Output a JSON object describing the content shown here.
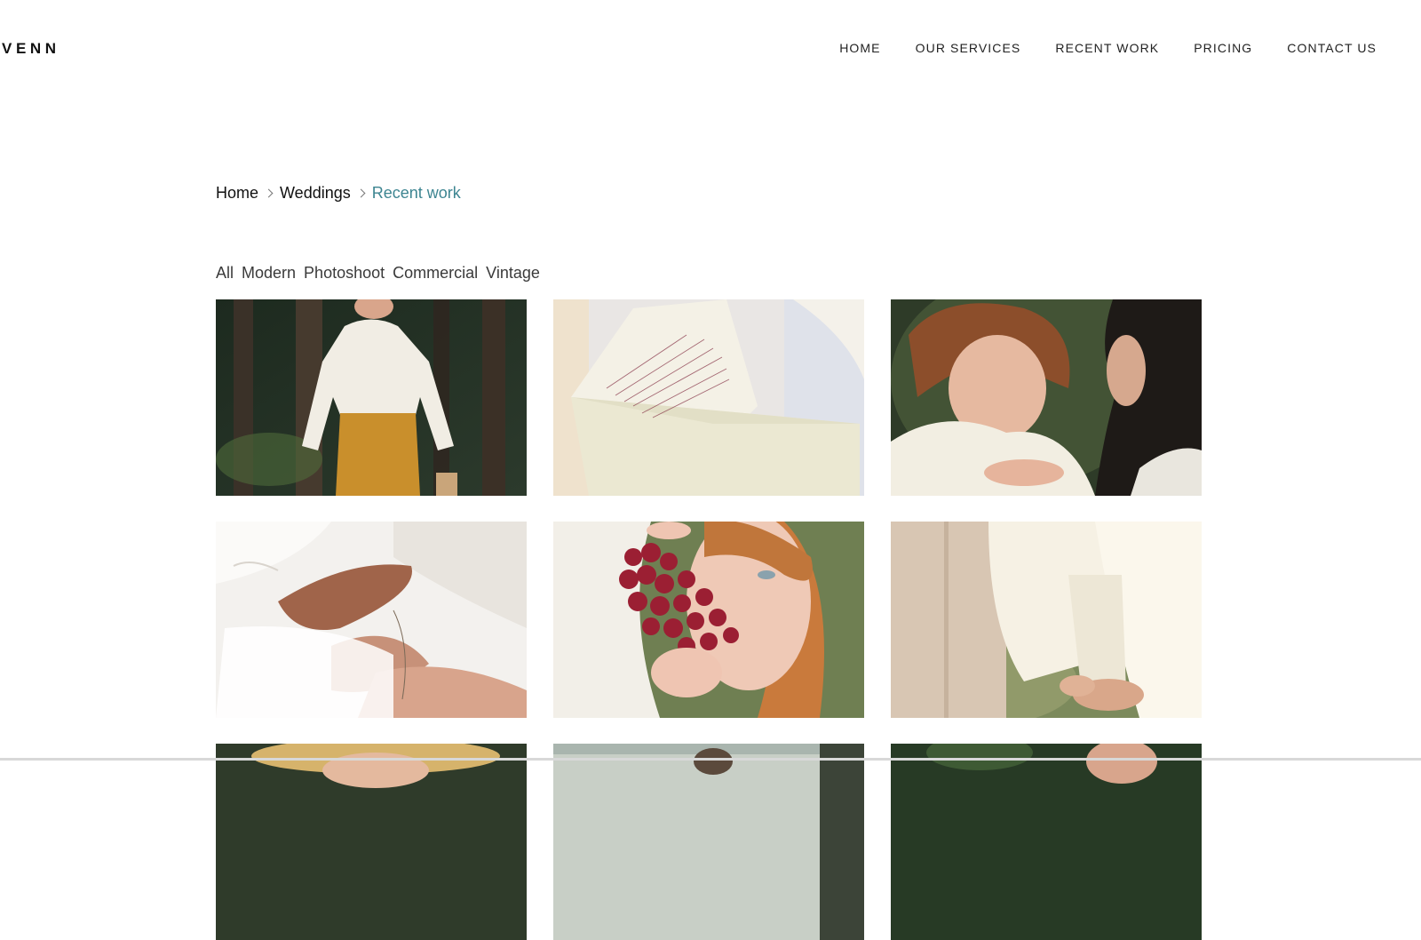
{
  "header": {
    "logo": "VENN",
    "nav": [
      {
        "label": "HOME"
      },
      {
        "label": "OUR SERVICES"
      },
      {
        "label": "RECENT WORK"
      },
      {
        "label": "PRICING"
      },
      {
        "label": "CONTACT US"
      }
    ]
  },
  "breadcrumb": {
    "items": [
      "Home",
      "Weddings",
      "Recent work"
    ]
  },
  "filters": [
    "All",
    "Modern",
    "Photoshoot",
    "Commercial",
    "Vintage"
  ],
  "colors": {
    "accent": "#3d8591",
    "text": "#111111",
    "muted": "#3a3a3a"
  },
  "gallery": {
    "images": [
      {
        "subject": "woman in white ruffled blouse and mustard trousers in forest"
      },
      {
        "subject": "handwritten letter in cream envelope"
      },
      {
        "subject": "two women face to face, red-haired woman in white blouse"
      },
      {
        "subject": "hands fastening white lace sleeve"
      },
      {
        "subject": "red-haired woman with bunch of red grapes"
      },
      {
        "subject": "two women in white holding hands outdoors"
      },
      {
        "subject": "woman in straw hat"
      },
      {
        "subject": "portrait near water"
      },
      {
        "subject": "smiling person in garden"
      }
    ]
  }
}
